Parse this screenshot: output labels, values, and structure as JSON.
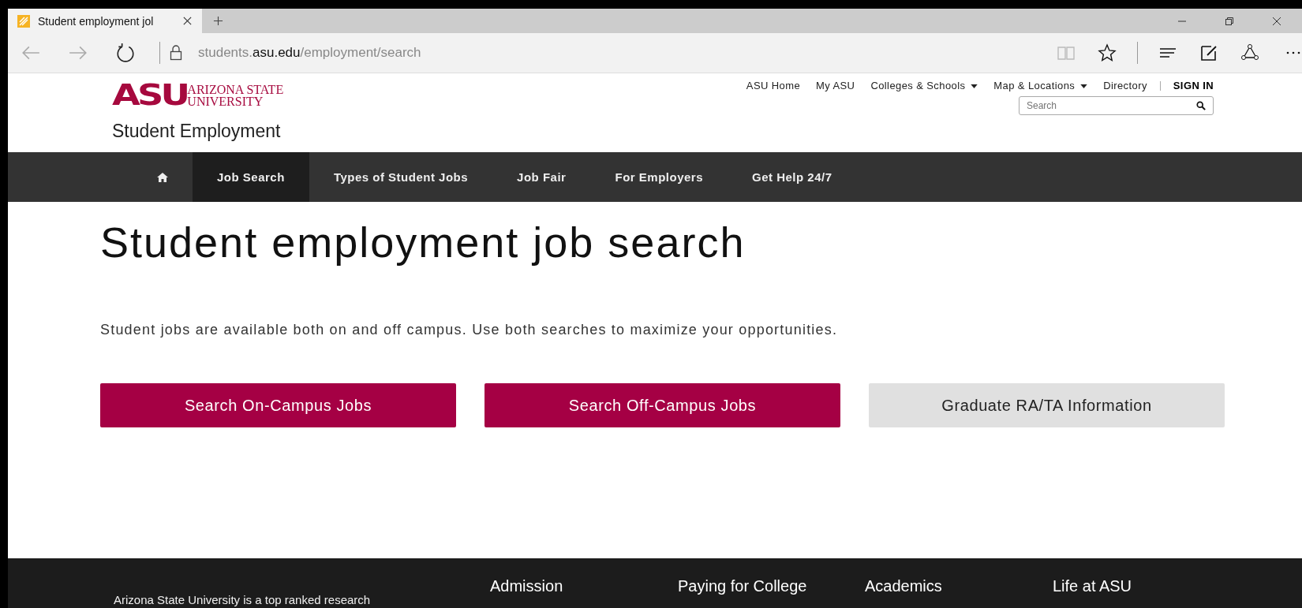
{
  "browser": {
    "tab_title": "Student employment jol",
    "url": "students.**asu.edu**/employment/search"
  },
  "header": {
    "logo": {
      "mark": "ASU",
      "line_1": "ARIZONA STATE",
      "line_2": "UNIVERSITY"
    },
    "site_title": "Student Employment",
    "top_links": [
      {
        "label": "ASU Home",
        "dropdown": false
      },
      {
        "label": "My ASU",
        "dropdown": false
      },
      {
        "label": "Colleges & Schools",
        "dropdown": true
      },
      {
        "label": "Map & Locations",
        "dropdown": true
      },
      {
        "label": "Directory",
        "dropdown": false
      }
    ],
    "sign_in": "SIGN IN",
    "search": {
      "placeholder": "Search"
    }
  },
  "nav": [
    {
      "kind": "home",
      "selected": false
    },
    {
      "kind": "link",
      "label": "Job Search",
      "selected": true
    },
    {
      "kind": "link",
      "label": "Types of Student Jobs",
      "selected": false
    },
    {
      "kind": "link",
      "label": "Job Fair",
      "selected": false
    },
    {
      "kind": "link",
      "label": "For Employers",
      "selected": false
    },
    {
      "kind": "link",
      "label": "Get Help 24/7",
      "selected": false
    }
  ],
  "heading": "Student employment job search",
  "intro": "Student jobs are available both on and off campus. Use both searches to maximize your opportunities.",
  "buttons": [
    {
      "label": "Search On-Campus Jobs",
      "kind": "primary"
    },
    {
      "label": "Search Off-Campus Jobs",
      "kind": "primary"
    },
    {
      "label": "Graduate RA/TA Information",
      "kind": "secondary"
    }
  ],
  "footer": {
    "blurb": "Arizona State University is a top ranked research",
    "columns": [
      "Admission",
      "Paying for College",
      "Academics",
      "Life at ASU"
    ]
  }
}
